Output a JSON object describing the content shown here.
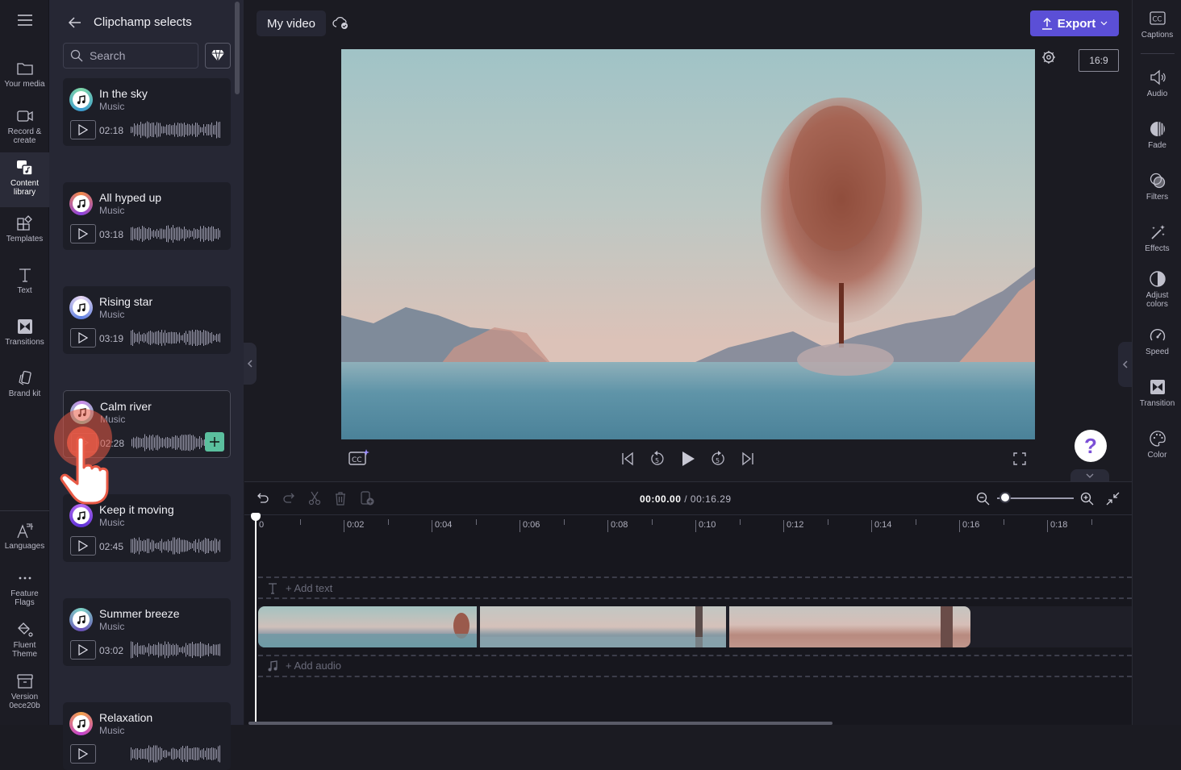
{
  "left_rail": {
    "items": [
      {
        "label": "Your media",
        "icon": "folder-icon"
      },
      {
        "label": "Record & create",
        "icon": "camera-icon"
      },
      {
        "label": "Content library",
        "icon": "content-library-icon",
        "active": true
      },
      {
        "label": "Templates",
        "icon": "templates-icon"
      },
      {
        "label": "Text",
        "icon": "text-icon"
      },
      {
        "label": "Transitions",
        "icon": "transitions-icon"
      },
      {
        "label": "Brand kit",
        "icon": "brand-kit-icon"
      },
      {
        "label": "Languages",
        "icon": "languages-icon"
      },
      {
        "label": "Feature Flags",
        "icon": "more-icon"
      },
      {
        "label": "Fluent Theme",
        "icon": "paint-bucket-icon"
      },
      {
        "label": "Version 0ece20b",
        "icon": "archive-icon"
      }
    ]
  },
  "panel": {
    "title": "Clipchamp selects",
    "search_placeholder": "Search",
    "tracks": [
      {
        "title": "In the sky",
        "type": "Music",
        "duration": "02:18",
        "ring": [
          "#7ed6a8",
          "#3b9bd1"
        ]
      },
      {
        "title": "All hyped up",
        "type": "Music",
        "duration": "03:18",
        "ring": [
          "#f28a4b",
          "#8b3fe0"
        ]
      },
      {
        "title": "Rising star",
        "type": "Music",
        "duration": "03:19",
        "ring": [
          "#e7d6f2",
          "#5d7fe0"
        ]
      },
      {
        "title": "Calm river",
        "type": "Music",
        "duration": "02:28",
        "ring": [
          "#c98be8",
          "#6fd1b0"
        ],
        "hovered": true
      },
      {
        "title": "Keep it moving",
        "type": "Music",
        "duration": "02:45",
        "ring": [
          "#b56cf0",
          "#5b2fd6"
        ]
      },
      {
        "title": "Summer breeze",
        "type": "Music",
        "duration": "03:02",
        "ring": [
          "#7dd3c6",
          "#6a4fb8"
        ]
      },
      {
        "title": "Relaxation",
        "type": "Music",
        "duration": "",
        "ring": [
          "#f2a24b",
          "#c23fd0"
        ]
      }
    ]
  },
  "topbar": {
    "project_title": "My video",
    "export_label": "Export",
    "aspect_ratio": "16:9"
  },
  "right_rail": {
    "items": [
      {
        "label": "Captions",
        "icon": "captions-icon"
      },
      {
        "label": "Audio",
        "icon": "speaker-icon"
      },
      {
        "label": "Fade",
        "icon": "fade-icon"
      },
      {
        "label": "Filters",
        "icon": "filters-icon"
      },
      {
        "label": "Effects",
        "icon": "magic-wand-icon"
      },
      {
        "label": "Adjust colors",
        "icon": "contrast-icon"
      },
      {
        "label": "Speed",
        "icon": "speedometer-icon"
      },
      {
        "label": "Transition",
        "icon": "transition-icon"
      },
      {
        "label": "Color",
        "icon": "palette-icon"
      }
    ]
  },
  "player": {
    "help_label": "?"
  },
  "timeline": {
    "current_time": "00:00.00",
    "separator": " / ",
    "total_time": "00:16.29",
    "ruler_labels": [
      "0",
      "0:02",
      "0:04",
      "0:06",
      "0:08",
      "0:10",
      "0:12",
      "0:14",
      "0:16",
      "0:18"
    ],
    "add_text_label": "+ Add text",
    "add_audio_label": "+ Add audio",
    "zoom_level": 0.1
  },
  "colors": {
    "accent": "#5b4fd6",
    "add_button": "#5bbf9e",
    "tap_indicator": "#e85a46"
  }
}
